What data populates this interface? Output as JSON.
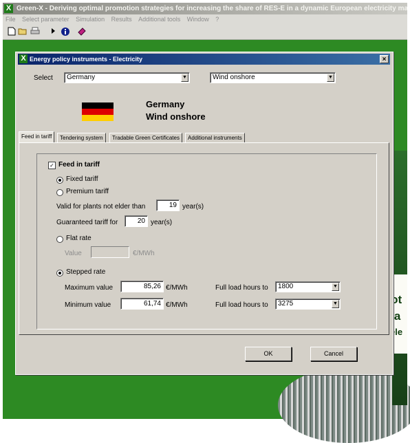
{
  "app": {
    "title": "Green-X - Deriving optimal promotion strategies for increasing the share of RES-E in a dynamic European electricity market",
    "logo": "X",
    "menu": [
      "File",
      "Select parameter",
      "Simulation",
      "Results",
      "Additional tools",
      "Window",
      "?"
    ],
    "toolbar_icons": [
      "new-file-icon",
      "open-folder-icon",
      "print-icon",
      "play-icon",
      "info-icon",
      "eraser-icon"
    ]
  },
  "background": {
    "big_text": [
      "mot",
      "sha",
      "ele"
    ]
  },
  "dialog": {
    "title": "Energy policy instruments - Electricity",
    "close_label": "×",
    "select_label": "Select",
    "country": "Germany",
    "technology": "Wind onshore",
    "heading_country": "Germany",
    "heading_technology": "Wind onshore",
    "flag_colors": [
      "#000000",
      "#dd0000",
      "#ffce00"
    ],
    "tabs": [
      "Feed in tariff",
      "Tendering system",
      "Tradable Green Certificates",
      "Additional instruments"
    ],
    "active_tab": "Feed in tariff",
    "feed_in": {
      "enabled_label": "Feed in tariff",
      "enabled": true,
      "fixed_tariff_label": "Fixed tariff",
      "premium_tariff_label": "Premium tariff",
      "tariff_type": "Fixed tariff",
      "valid_label": "Valid for plants not elder than",
      "valid_value": "19",
      "valid_unit": "year(s)",
      "guaranteed_label": "Guaranteed tariff for",
      "guaranteed_value": "20",
      "guaranteed_unit": "year(s)",
      "flat_rate_label": "Flat rate",
      "flat_value_label": "Value",
      "flat_value": "",
      "flat_unit": "€/MWh",
      "stepped_rate_label": "Stepped rate",
      "rate_type": "Stepped rate",
      "max_label": "Maximum value",
      "max_value": "85,26",
      "max_unit": "€/MWh",
      "min_label": "Minimum value",
      "min_value": "61,74",
      "min_unit": "€/MWh",
      "full_load_label_1": "Full load hours to",
      "full_load_value_1": "1800",
      "full_load_label_2": "Full load hours to",
      "full_load_value_2": "3275"
    },
    "ok_label": "OK",
    "cancel_label": "Cancel"
  }
}
